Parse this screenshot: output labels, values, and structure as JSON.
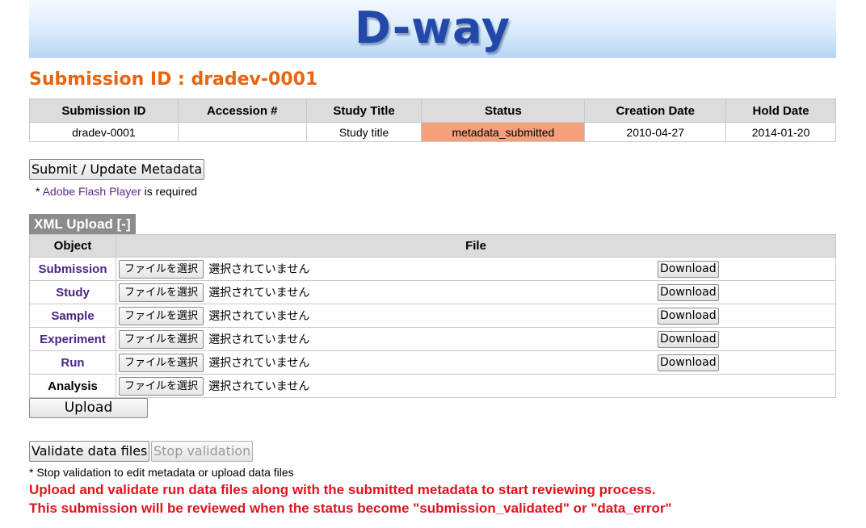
{
  "header": {
    "logo": "D-way"
  },
  "page_title": "Submission ID : dradev-0001",
  "info_table": {
    "columns": [
      "Submission ID",
      "Accession #",
      "Study Title",
      "Status",
      "Creation Date",
      "Hold Date"
    ],
    "row": {
      "submission_id": "dradev-0001",
      "accession": "",
      "study_title": "Study title",
      "status": "metadata_submitted",
      "creation_date": "2010-04-27",
      "hold_date": "2014-01-20"
    },
    "status_color": "#f5a07a"
  },
  "submit_button": "Submit / Update Metadata",
  "flash_note": {
    "prefix": "* ",
    "link": "Adobe Flash Player",
    "suffix": " is required"
  },
  "xml_upload": {
    "title": "XML Upload [-]",
    "columns": [
      "Object",
      "File"
    ],
    "choose_label": "ファイルを選択",
    "no_file_label": "選択されていません",
    "download_label": "Download",
    "rows": [
      {
        "object": "Submission"
      },
      {
        "object": "Study"
      },
      {
        "object": "Sample"
      },
      {
        "object": "Experiment"
      },
      {
        "object": "Run"
      },
      {
        "object": "Analysis"
      }
    ],
    "upload_button": "Upload"
  },
  "validate_button": "Validate data files",
  "stop_button": "Stop validation",
  "stop_note": "* Stop validation to edit metadata or upload data files",
  "warnings": [
    "Upload and validate run data files along with the submitted metadata to start reviewing process.",
    "This submission will be reviewed when the status become \"submission_validated\" or \"data_error\""
  ],
  "colors": {
    "title_orange": "#e8650f",
    "warning_red": "#e0141e",
    "link_purple": "#5b2c8a",
    "logo_blue": "#2249a8"
  }
}
